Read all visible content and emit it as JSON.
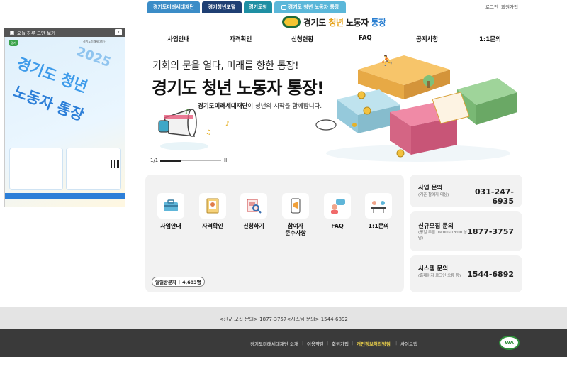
{
  "top_tabs": [
    {
      "label": "경기도미래세대재단",
      "color": "#3b8cc7"
    },
    {
      "label": "경기청년포털",
      "color": "#1f3f73"
    },
    {
      "label": "경기도청",
      "color": "#1e8fa3"
    },
    {
      "label": "경기도 청년 노동자 통장",
      "color": "#5bb7d9"
    }
  ],
  "util_links": {
    "login": "로그인",
    "signup": "회원가입"
  },
  "logo": {
    "part1": "경기도 ",
    "part2": "청년",
    "part3": " 노동자 ",
    "part4": "통장"
  },
  "nav": [
    "사업안내",
    "자격확인",
    "신청현황",
    "FAQ",
    "공지사항",
    "1:1문의"
  ],
  "popup": {
    "checkbox_label": "오늘 하루 그만 보기",
    "close": "x",
    "poster_year": "2025",
    "poster_line1": "경기도 청년",
    "poster_line2": "노동자 통장",
    "poster_badge": "경기",
    "poster_org": "경기도미래세대재단"
  },
  "hero": {
    "subtitle": "기회의 문을 열다, 미래를 향한 통장!",
    "title": "경기도 청년 노동자 통장!",
    "desc_org": "경기도미래세대재단",
    "desc_rest": "이 청년의 시작을 함께합니다.",
    "slide_counter": "1/1",
    "pause": "II"
  },
  "quick_links": [
    {
      "label": "사업안내",
      "icon": "briefcase-icon"
    },
    {
      "label": "자격확인",
      "icon": "certificate-icon"
    },
    {
      "label": "신청하기",
      "icon": "search-form-icon"
    },
    {
      "label": "참여자\n준수사항",
      "icon": "megaphone-phone-icon"
    },
    {
      "label": "FAQ",
      "icon": "chat-person-icon"
    },
    {
      "label": "1:1문의",
      "icon": "consult-desk-icon"
    }
  ],
  "visitors": {
    "label": "일일방문자",
    "count": "4,683명"
  },
  "contacts": [
    {
      "title": "사업 문의",
      "sub": "(기존 참여자 대상)",
      "number": "031-247-6935"
    },
    {
      "title": "신규모집 문의",
      "sub": "(평일 주말 09:00~18:00 상담)",
      "number": "1877-3757"
    },
    {
      "title": "시스템 문의",
      "sub": "(홈페이지 로그인 오류 등)",
      "number": "1544-6892"
    }
  ],
  "footer": {
    "contact_line": "<신규 모집 문의> 1877-3757<시스템 문의> 1544-6892",
    "links": [
      "경기도미래세대재단 소개",
      "이용약관",
      "회원가입",
      "개인정보처리방침",
      "사이트맵"
    ],
    "highlight_color": "#f2d64b",
    "wa_mark": "WA"
  }
}
